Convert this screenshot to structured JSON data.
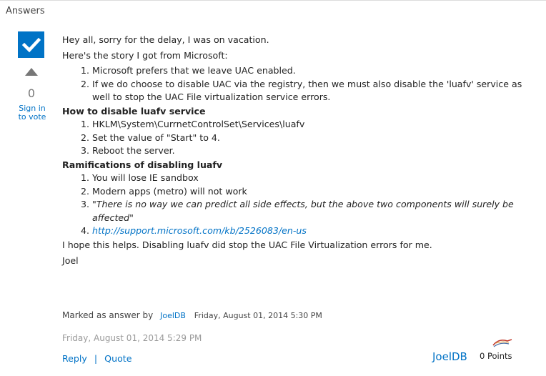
{
  "section": {
    "title": "Answers"
  },
  "vote": {
    "count": "0",
    "sign_in_line1": "Sign in",
    "sign_in_line2": "to vote"
  },
  "post": {
    "greeting": "Hey all, sorry for the delay, I was on vacation.",
    "intro": "Here's the story I got from Microsoft:",
    "story_items": [
      "Microsoft prefers that we leave UAC enabled.",
      "If we do choose to disable UAC via the registry, then we must also disable the 'luafv' service as well to stop the UAC File virtualization service errors."
    ],
    "how_heading": "How to disable luafv service",
    "how_items": [
      "HKLM\\System\\CurrnetControlSet\\Services\\luafv",
      "Set the value of \"Start\" to 4.",
      "Reboot the server."
    ],
    "ram_heading": "Ramifications of disabling luafv",
    "ram_items": [
      "You will lose IE sandbox",
      "Modern apps (metro) will not work",
      "\"There is no way we can predict all side effects, but the above two components will surely be affected\"",
      "http://support.microsoft.com/kb/2526083/en-us"
    ],
    "closing": "I hope this helps. Disabling luafv did stop the UAC File Virtualization errors for me.",
    "signature": "Joel"
  },
  "marked": {
    "label": "Marked as answer by",
    "by": "JoelDB",
    "date": "Friday, August 01, 2014 5:30 PM"
  },
  "post_date": "Friday, August 01, 2014 5:29 PM",
  "actions": {
    "reply": "Reply",
    "separator": "|",
    "quote": "Quote"
  },
  "author": {
    "name": "JoelDB",
    "points": "0 Points"
  },
  "colors": {
    "accent": "#0072c6",
    "check_bg": "#0073c6",
    "muted": "#9a9a9a"
  },
  "icons": {
    "answer": "checkmark-icon",
    "vote_up": "triangle-up-icon",
    "avatar": "avatar-icon"
  }
}
